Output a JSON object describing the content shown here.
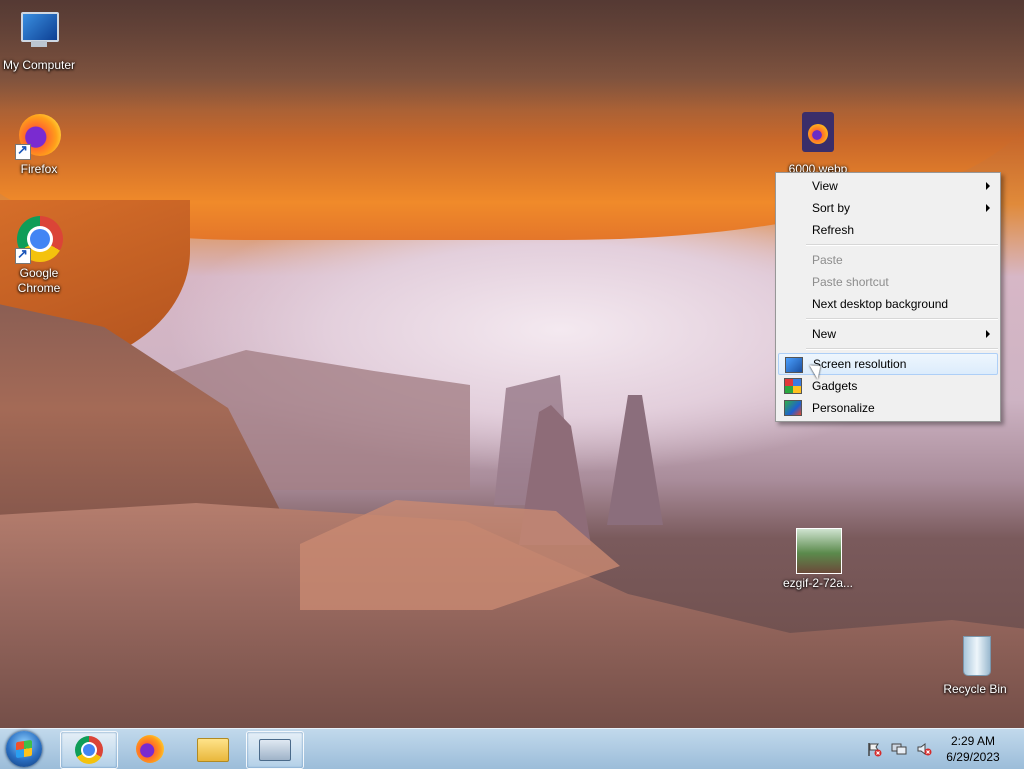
{
  "desktop_icons": {
    "my_computer": "My Computer",
    "firefox": "Firefox",
    "google_chrome": "Google Chrome",
    "webp_file": "6000.webp",
    "gif_file": "ezgif-2-72a...",
    "recycle_bin": "Recycle Bin"
  },
  "context_menu": {
    "items": [
      {
        "label": "View",
        "submenu": true,
        "enabled": true
      },
      {
        "label": "Sort by",
        "submenu": true,
        "enabled": true
      },
      {
        "label": "Refresh",
        "enabled": true
      },
      {
        "label": "Paste",
        "enabled": false
      },
      {
        "label": "Paste shortcut",
        "enabled": false
      },
      {
        "label": "Next desktop background",
        "enabled": true
      },
      {
        "label": "New",
        "submenu": true,
        "enabled": true
      },
      {
        "label": "Screen resolution",
        "icon": "display-icon",
        "highlighted": true,
        "enabled": true
      },
      {
        "label": "Gadgets",
        "icon": "gadgets-icon",
        "enabled": true
      },
      {
        "label": "Personalize",
        "icon": "personalize-icon",
        "enabled": true
      }
    ]
  },
  "taskbar": {
    "pinned": [
      "chrome-icon",
      "firefox-icon",
      "folder-icon",
      "keyboard-icon"
    ],
    "tray_icons": [
      "action-center-flag-icon",
      "network-icon",
      "volume-muted-icon"
    ],
    "clock": {
      "time": "2:29 AM",
      "date": "6/29/2023"
    }
  }
}
